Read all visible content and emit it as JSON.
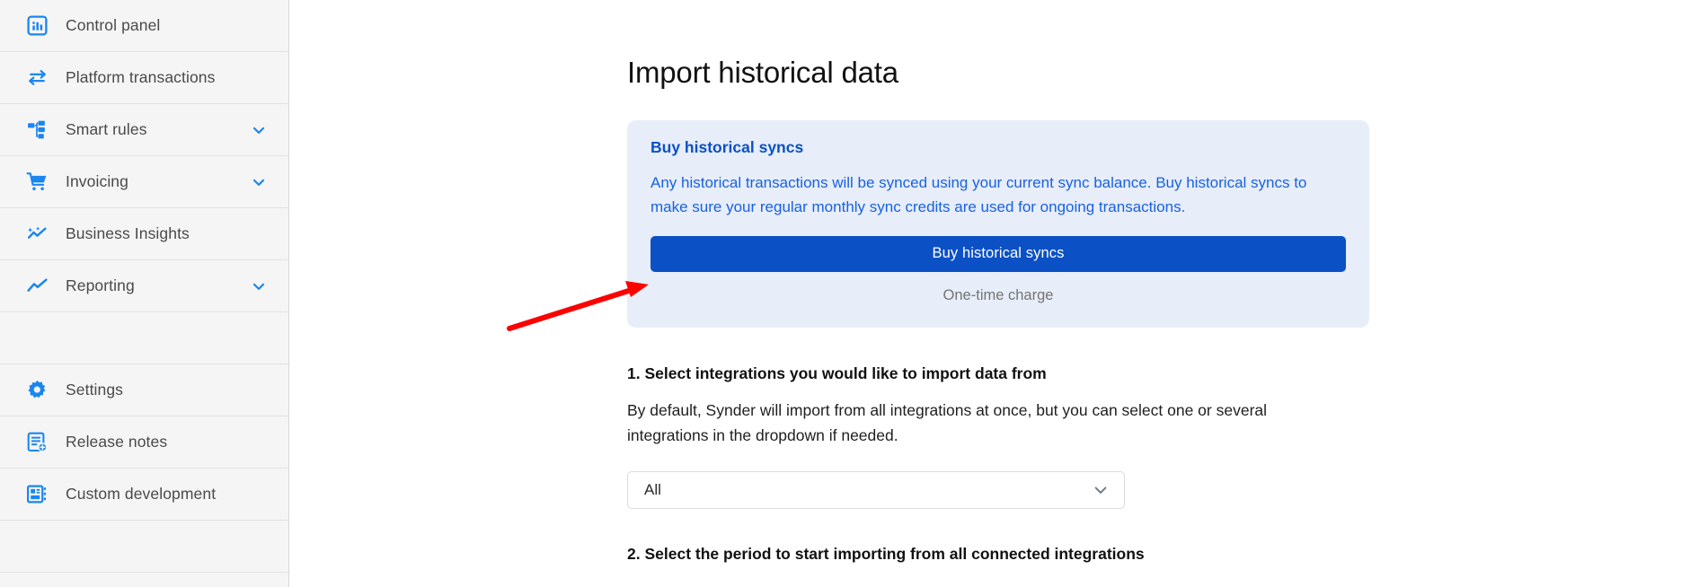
{
  "sidebar": {
    "items": [
      {
        "label": "Control panel",
        "icon": "dashboard-chart-icon",
        "chevron": false
      },
      {
        "label": "Platform transactions",
        "icon": "transfer-arrows-icon",
        "chevron": false
      },
      {
        "label": "Smart rules",
        "icon": "sitemap-rules-icon",
        "chevron": true
      },
      {
        "label": "Invoicing",
        "icon": "shopping-cart-icon",
        "chevron": true
      },
      {
        "label": "Business Insights",
        "icon": "insights-sparkline-icon",
        "chevron": false
      },
      {
        "label": "Reporting",
        "icon": "line-chart-icon",
        "chevron": true
      },
      {
        "label": "",
        "icon": "",
        "chevron": false
      },
      {
        "label": "Settings",
        "icon": "gear-icon",
        "chevron": false
      },
      {
        "label": "Release notes",
        "icon": "document-plus-icon",
        "chevron": false
      },
      {
        "label": "Custom development",
        "icon": "custom-blocks-icon",
        "chevron": false
      }
    ]
  },
  "main": {
    "page_title": "Import historical data",
    "info_card": {
      "title": "Buy historical syncs",
      "body": "Any historical transactions will be synced using your current sync balance. Buy historical syncs to make sure your regular monthly sync credits are used for ongoing transactions.",
      "button_label": "Buy historical syncs",
      "footnote": "One-time charge"
    },
    "step1": {
      "heading": "1. Select integrations you would like to import data from",
      "description": "By default, Synder will import from all integrations at once, but you can select one or several integrations in the dropdown if needed.",
      "select_value": "All"
    },
    "step2": {
      "heading": "2. Select the period to start importing from all connected integrations"
    }
  },
  "colors": {
    "brand_blue": "#0b51c5",
    "icon_blue": "#1a86f0",
    "info_card_bg": "#e7edf9",
    "info_text": "#1a62e0",
    "sidebar_bg": "#f5f5f5",
    "annotation_red": "#fe0000"
  }
}
